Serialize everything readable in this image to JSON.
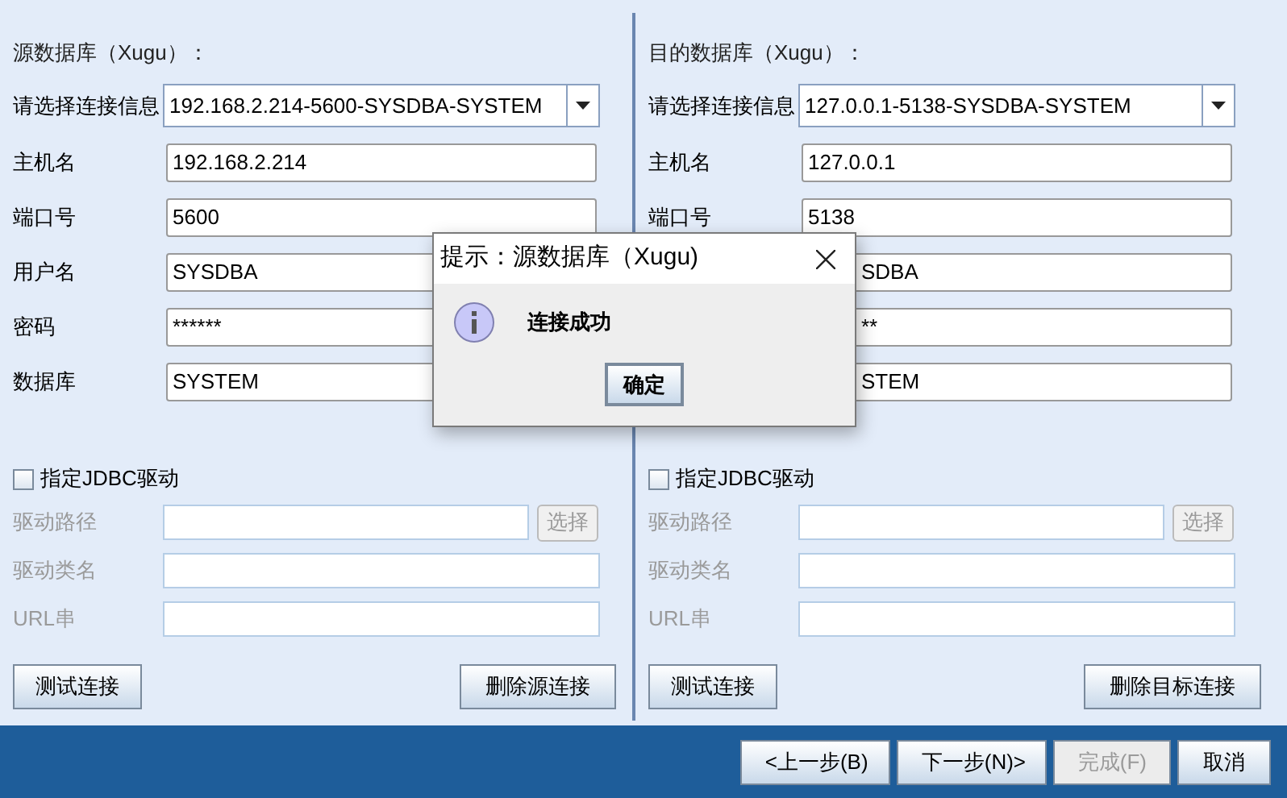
{
  "panels": [
    {
      "title": "源数据库（Xugu）：",
      "connection": {
        "label": "请选择连接信息",
        "value": "192.168.2.214-5600-SYSDBA-SYSTEM"
      },
      "fields": [
        {
          "label": "主机名",
          "value": "192.168.2.214",
          "kind": "text"
        },
        {
          "label": "端口号",
          "value": "5600",
          "kind": "text"
        },
        {
          "label": "用户名",
          "value": "SYSDBA",
          "kind": "text"
        },
        {
          "label": "密码",
          "value": "******",
          "kind": "text"
        },
        {
          "label": "数据库",
          "value": "SYSTEM",
          "kind": "text"
        }
      ],
      "jdbc": {
        "label": "指定JDBC驱动",
        "checked": false
      },
      "driver_fields": [
        {
          "label": "驱动路径",
          "disabled": true
        },
        {
          "label": "驱动类名",
          "disabled": true
        },
        {
          "label": "URL串",
          "disabled": true
        }
      ],
      "browse_button": {
        "label": "选择",
        "disabled": true
      },
      "test_button": "测试连接",
      "delete_button": "删除源连接"
    },
    {
      "title": "目的数据库（Xugu）：",
      "connection": {
        "label": "请选择连接信息",
        "value": "127.0.0.1-5138-SYSDBA-SYSTEM"
      },
      "fields": [
        {
          "label": "主机名",
          "value": "127.0.0.1",
          "kind": "text"
        },
        {
          "label": "端口号",
          "value": "5138",
          "kind": "text"
        },
        {
          "value": "SDBA",
          "kind": "covered"
        },
        {
          "value": "**",
          "kind": "covered"
        },
        {
          "value": "STEM",
          "kind": "covered"
        }
      ],
      "jdbc": {
        "label": "指定JDBC驱动",
        "checked": false
      },
      "driver_fields": [
        {
          "label": "驱动路径",
          "disabled": true
        },
        {
          "label": "驱动类名",
          "disabled": true
        },
        {
          "label": "URL串",
          "disabled": true
        }
      ],
      "browse_button": {
        "label": "选择",
        "disabled": true
      },
      "test_button": "测试连接",
      "delete_button": "删除目标连接"
    }
  ],
  "footer_buttons": [
    {
      "label": "<上一步(B)",
      "disabled": false
    },
    {
      "label": "下一步(N)>",
      "disabled": false
    },
    {
      "label": "完成(F)",
      "disabled": true
    },
    {
      "label": "取消",
      "disabled": false
    }
  ],
  "dialog": {
    "title": "提示：源数据库（Xugu)",
    "message": "连接成功",
    "ok_button": "确定"
  }
}
